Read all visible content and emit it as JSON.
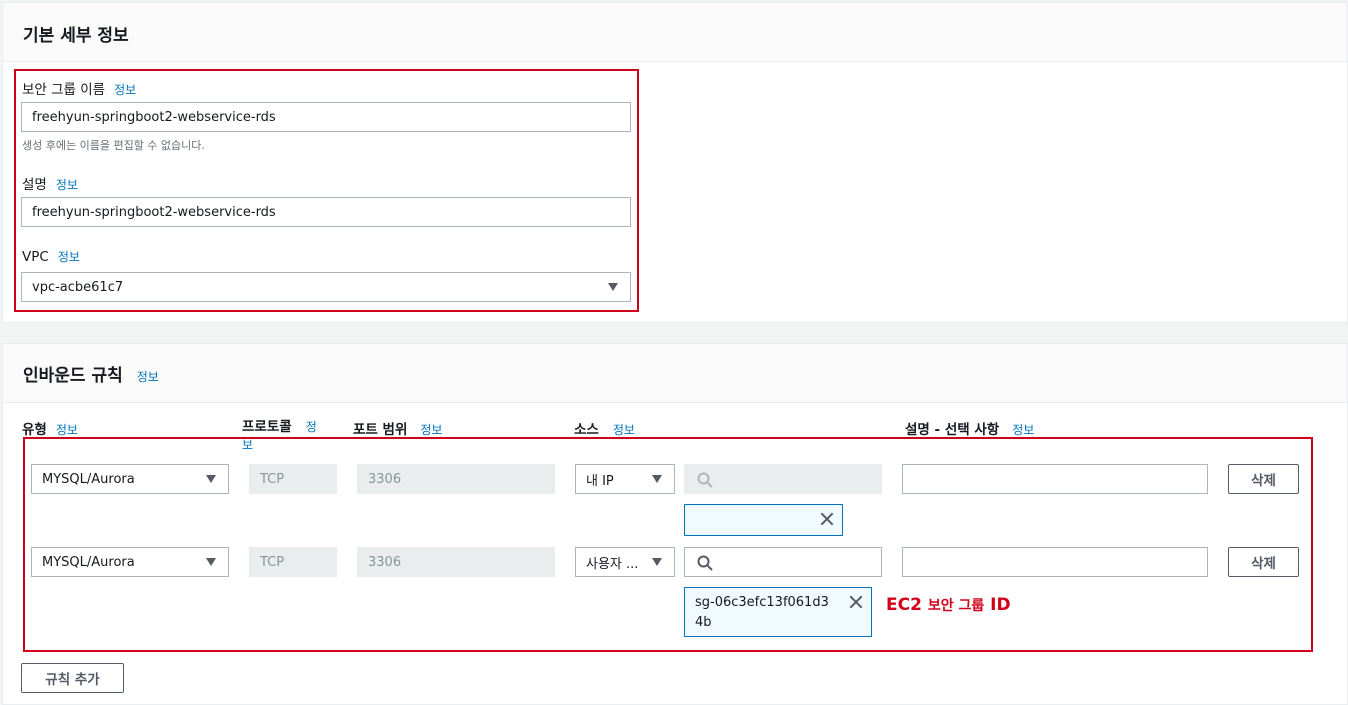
{
  "basic": {
    "title": "기본 세부 정보",
    "sg_name_label": "보안 그룹 이름",
    "info": "정보",
    "sg_name_value": "freehyun-springboot2-webservice-rds",
    "sg_name_hint": "생성 후에는 이름을 편집할 수 없습니다.",
    "desc_label": "설명",
    "desc_value": "freehyun-springboot2-webservice-rds",
    "vpc_label": "VPC",
    "vpc_value": "vpc-acbe61c7"
  },
  "inbound": {
    "title": "인바운드 규칙",
    "info": "정보",
    "columns": {
      "type": "유형",
      "protocol_line1": "프로토콜",
      "protocol_info1": "정",
      "protocol_info2": "보",
      "port": "포트 범위",
      "source": "소스",
      "desc": "설명 - 선택 사항"
    },
    "rules": [
      {
        "type": "MYSQL/Aurora",
        "protocol": "TCP",
        "port": "3306",
        "source": "내 IP",
        "search": "",
        "token": "",
        "desc": "",
        "delete": "삭제"
      },
      {
        "type": "MYSQL/Aurora",
        "protocol": "TCP",
        "port": "3306",
        "source": "사용자 ...",
        "search": "",
        "token_line1": "sg-06c3efc13f061d3",
        "token_line2": "4b",
        "desc": "",
        "delete": "삭제"
      }
    ],
    "add_rule": "규칙 추가"
  },
  "annotation": {
    "strong1": "EC2",
    "text": "보안 그룹",
    "strong2": "ID"
  },
  "colors": {
    "accent": "#0073bb",
    "annotation": "#d0021b"
  }
}
